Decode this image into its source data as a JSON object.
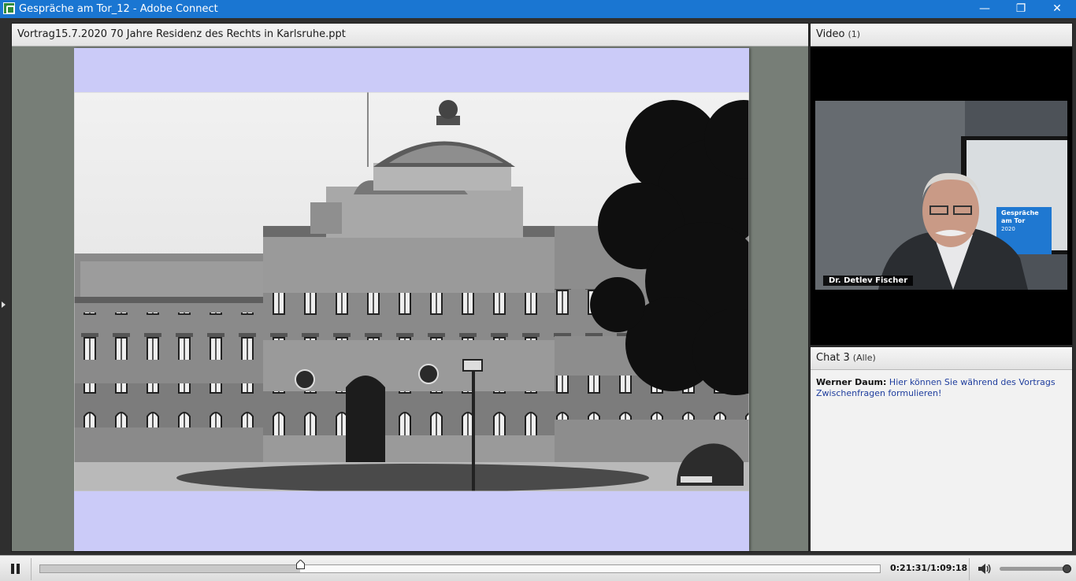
{
  "window": {
    "title": "Gespräche am Tor_12 - Adobe Connect",
    "controls": {
      "minimize": "—",
      "maximize": "❐",
      "close": "✕"
    }
  },
  "share_pod": {
    "title": "Vortrag15.7.2020 70 Jahre Residenz des Rechts in Karlsruhe.ppt"
  },
  "video_pod": {
    "label": "Video",
    "count": "(1)",
    "participant_name": "Dr. Detlev Fischer",
    "background_screen_text": [
      "Gespräche",
      "am Tor",
      "2020"
    ]
  },
  "chat_pod": {
    "label": "Chat 3",
    "scope": "(Alle)",
    "messages": [
      {
        "sender": "Werner Daum:",
        "text": "Hier können Sie während des Vortrags Zwischenfragen formulieren!"
      }
    ]
  },
  "playback": {
    "time_readout": "0:21:31/1:09:18",
    "progress_fraction": 0.31,
    "volume_fraction": 1.0,
    "state": "playing"
  },
  "colors": {
    "titlebar": "#1a76d2",
    "slide_background": "#cbcbf8",
    "chat_link_text": "#1f3e9e"
  },
  "icons": [
    "adobe-connect-app-icon",
    "pause-icon",
    "volume-icon",
    "seek-thumb-icon"
  ]
}
